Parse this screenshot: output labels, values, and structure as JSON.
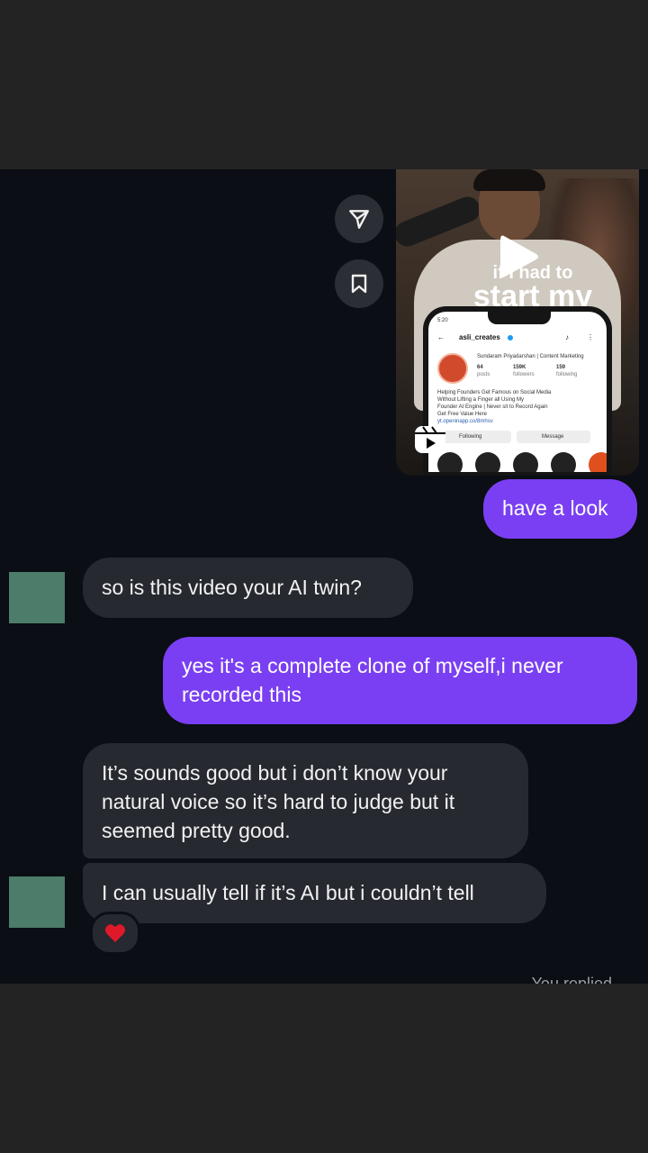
{
  "video": {
    "overlay_text_line1": "if I had to",
    "overlay_text_line2": "start my",
    "profile": {
      "status_time": "5:20",
      "username": "asli_creates",
      "display_name": "Sundaram Priyadarshan | Content Marketing",
      "posts_count": "64",
      "posts_label": "posts",
      "followers_count": "159K",
      "followers_label": "followers",
      "following_count": "159",
      "following_label": "following",
      "bio_line1": "Helping Founders Get Famous on Social Media",
      "bio_line2": "Without Lifting a Finger all Using My",
      "bio_line3": "Founder AI Engine | Never sit to Record Again",
      "bio_line4": "Get Free Value Here",
      "link": "yt.openinapp.co/8mhsv",
      "following_button": "Following",
      "message_button": "Message"
    }
  },
  "messages": [
    {
      "id": "m1",
      "direction": "outgoing",
      "text": "have a look"
    },
    {
      "id": "m2",
      "direction": "incoming",
      "text": "so is this video your AI twin?"
    },
    {
      "id": "m3",
      "direction": "outgoing",
      "text": "yes it's a complete clone of myself,i never recorded this"
    },
    {
      "id": "m4",
      "direction": "incoming",
      "text": "It’s sounds good but i don’t know your natural voice so it’s hard to judge but it seemed pretty good."
    },
    {
      "id": "m5",
      "direction": "incoming",
      "text": "I can usually tell if it’s AI but i couldn’t tell"
    }
  ],
  "reaction": {
    "emoji": "❤️"
  },
  "status": {
    "replied": "You replied"
  },
  "colors": {
    "outgoing_bubble": "#7a3ff2",
    "incoming_bubble": "#26292f",
    "chat_bg": "#0b0e14",
    "avatar": "#4c7c6a"
  },
  "icons": [
    "send-icon",
    "bookmark-icon",
    "play-icon",
    "reels-icon",
    "heart-icon"
  ]
}
